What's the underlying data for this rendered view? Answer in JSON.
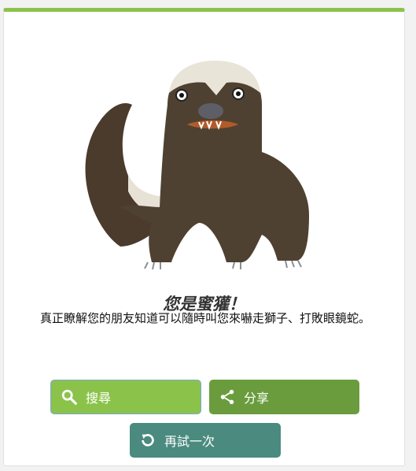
{
  "result": {
    "title": "您是蜜獾！",
    "description": "真正瞭解您的朋友知道可以隨時叫您來嚇走獅子、打敗眼鏡蛇。"
  },
  "hero": {
    "image": "honey-badger-illustration"
  },
  "buttons": {
    "search_label": "搜尋",
    "share_label": "分享",
    "retry_label": "再試一次"
  },
  "icons": {
    "search": "search-icon",
    "share": "share-icon",
    "retry": "retry-icon"
  },
  "colors": {
    "accent": "#8bc34a",
    "share": "#6a9c3d",
    "retry": "#4a8a7f"
  }
}
